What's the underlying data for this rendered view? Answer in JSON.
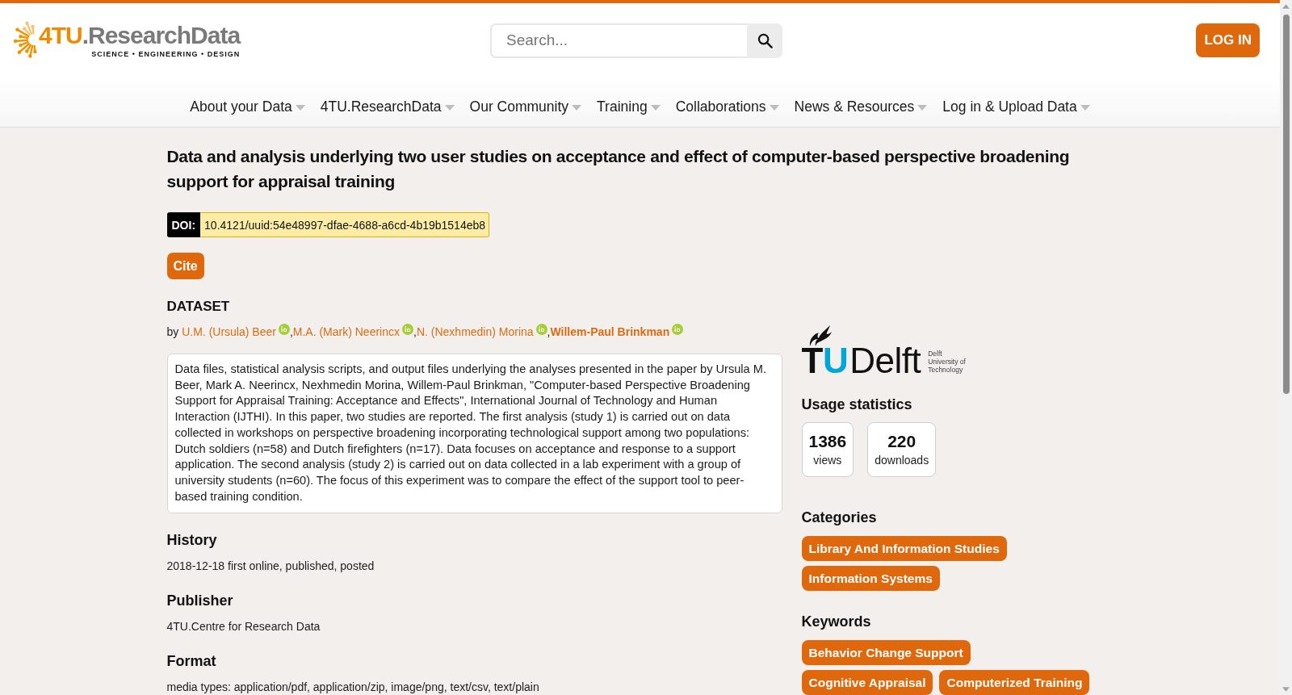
{
  "header": {
    "logo": {
      "mark": "4TU",
      "name": ".ResearchData",
      "tagline": "SCIENCE • ENGINEERING • DESIGN"
    },
    "search": {
      "placeholder": "Search..."
    },
    "login_button": "LOG IN"
  },
  "nav": [
    "About your Data",
    "4TU.ResearchData",
    "Our Community",
    "Training",
    "Collaborations",
    "News & Resources",
    "Log in & Upload Data"
  ],
  "dataset": {
    "title": "Data and analysis underlying two user studies on acceptance and effect of computer-based perspective broadening support for appraisal training",
    "doi": {
      "label": "DOI:",
      "value": "10.4121/uuid:54e48997-dfae-4688-a6cd-4b19b1514eb8"
    },
    "cite_button": "Cite",
    "type": "DATASET",
    "byline": {
      "prefix": "by",
      "authors": [
        {
          "name": "U.M. (Ursula) Beer",
          "bold": false,
          "separator": ","
        },
        {
          "name": "M.A. (Mark) Neerincx",
          "bold": false,
          "separator": ","
        },
        {
          "name": "N. (Nexhmedin) Morina",
          "bold": false,
          "separator": ","
        },
        {
          "name": "Willem-Paul Brinkman",
          "bold": true
        }
      ]
    },
    "description": "Data files, statistical analysis scripts, and output files underlying the analyses presented in the paper by Ursula M. Beer, Mark A. Neerincx, Nexhmedin Morina, Willem-Paul Brinkman, \"Computer-based Perspective Broadening Support for Appraisal Training: Acceptance and Effects\", International Journal of Technology and Human Interaction (IJTHI). In this paper, two studies are reported. The first analysis (study 1) is carried out on data collected in workshops on perspective broadening incorporating technological support among two populations: Dutch soldiers (n=58) and Dutch firefighters (n=17). Data focuses on acceptance and response to a support application. The second analysis (study 2) is carried out on data collected in a lab experiment with a group of university students (n=60). The focus of this experiment was to compare the effect of the support tool to peer-based training condition.",
    "sections": [
      {
        "heading": "History",
        "text": "2018-12-18 first online, published, posted"
      },
      {
        "heading": "Publisher",
        "text": "4TU.Centre for Research Data"
      },
      {
        "heading": "Format",
        "text": "media types: application/pdf, application/zip, image/png, text/csv, text/plain"
      }
    ]
  },
  "sidebar": {
    "institution_logo": {
      "initials": [
        "T",
        "U"
      ],
      "name": "Delft",
      "lines": [
        "Delft",
        "University of",
        "Technology"
      ]
    },
    "usage": {
      "heading": "Usage statistics",
      "stats": [
        {
          "value": "1386",
          "label": "views"
        },
        {
          "value": "220",
          "label": "downloads"
        }
      ]
    },
    "categories": {
      "heading": "Categories",
      "tags": [
        "Library And Information Studies",
        "Information Systems"
      ]
    },
    "keywords": {
      "heading": "Keywords",
      "tags": [
        "Behavior Change Support",
        "Cognitive Appraisal",
        "Computerized Training"
      ]
    }
  }
}
